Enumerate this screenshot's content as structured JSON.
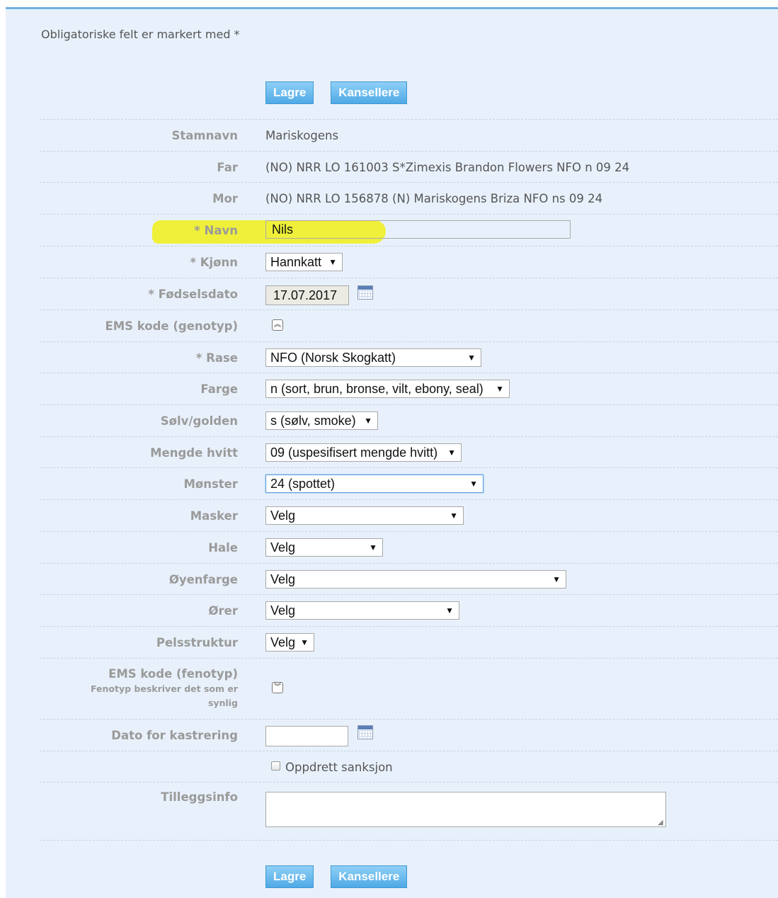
{
  "form": {
    "required_note": "Obligatoriske felt er markert med *",
    "save_label": "Lagre",
    "cancel_label": "Kansellere",
    "stamnavn": {
      "label": "Stamnavn",
      "value": "Mariskogens"
    },
    "far": {
      "label": "Far",
      "value": "(NO) NRR LO 161003 S*Zimexis Brandon Flowers NFO n 09 24"
    },
    "mor": {
      "label": "Mor",
      "value": "(NO) NRR LO 156878 (N) Mariskogens Briza NFO ns 09 24"
    },
    "navn": {
      "label": "* Navn",
      "value": "Nils"
    },
    "kjonn": {
      "label": "* Kjønn",
      "value": "Hannkatt"
    },
    "fodselsdato": {
      "label": "* Fødselsdato",
      "value": "17.07.2017"
    },
    "ems_genotyp": {
      "label": "EMS kode (genotyp)"
    },
    "rase": {
      "label": "* Rase",
      "value": "NFO (Norsk Skogkatt)"
    },
    "farge": {
      "label": "Farge",
      "value": "n (sort, brun, bronse, vilt, ebony, seal)"
    },
    "solv": {
      "label": "Sølv/golden",
      "value": "s (sølv, smoke)"
    },
    "hvitt": {
      "label": "Mengde hvitt",
      "value": "09 (uspesifisert mengde hvitt)"
    },
    "monster": {
      "label": "Mønster",
      "value": "24 (spottet)"
    },
    "masker": {
      "label": "Masker",
      "value": "Velg"
    },
    "hale": {
      "label": "Hale",
      "value": "Velg"
    },
    "oyenfarge": {
      "label": "Øyenfarge",
      "value": "Velg"
    },
    "orer": {
      "label": "Ører",
      "value": "Velg"
    },
    "pels": {
      "label": "Pelsstruktur",
      "value": "Velg"
    },
    "ems_fenotyp": {
      "label": "EMS kode (fenotyp)",
      "sub": "Fenotyp beskriver det som er synlig"
    },
    "kastrering": {
      "label": "Dato for kastrering",
      "value": ""
    },
    "sanksjon": {
      "label": "Oppdrett sanksjon"
    },
    "tillegg": {
      "label": "Tilleggsinfo",
      "value": ""
    }
  },
  "icons": {
    "calendar": "calendar-icon",
    "collapse": "chevron-double-up-icon",
    "expand": "chevron-double-down-icon",
    "dropdown": "dropdown-arrow-icon"
  },
  "colors": {
    "panel_bg": "#e8f1fb",
    "button_bg": "#4fa9e6",
    "highlight": "#f0f03a"
  }
}
